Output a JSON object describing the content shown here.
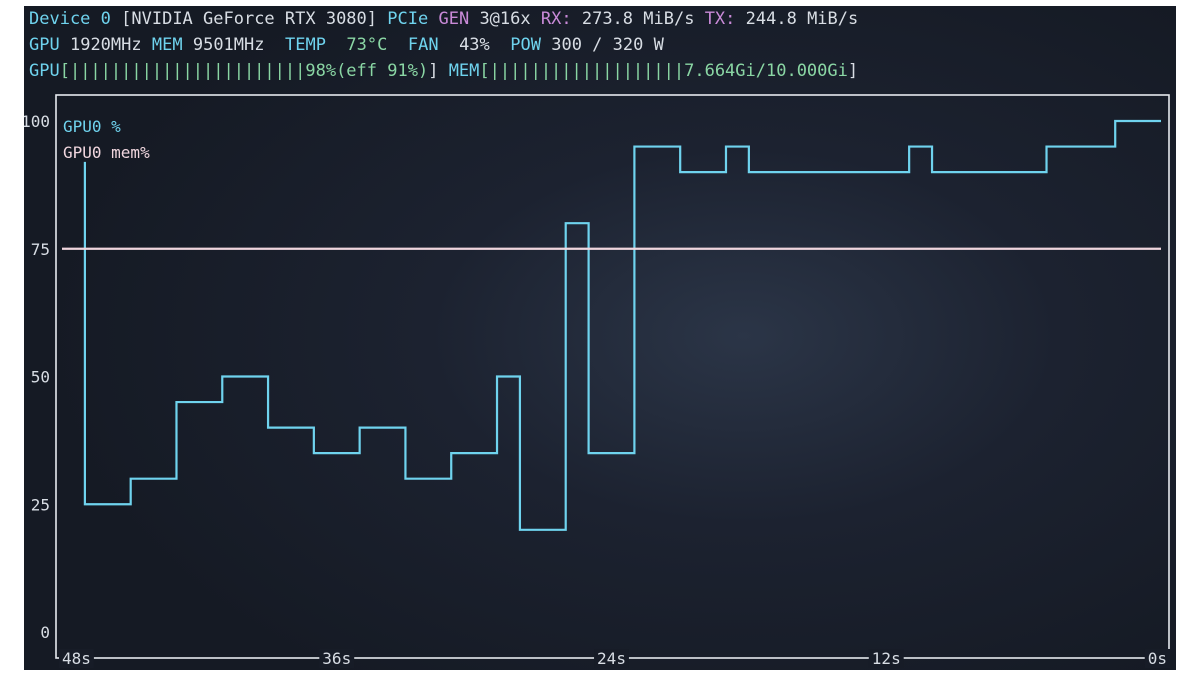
{
  "header": {
    "device": {
      "label": "Device 0",
      "name": "[NVIDIA GeForce RTX 3080]",
      "pcie_label": "PCIe",
      "gen_label": "GEN",
      "gen_value": "3@16x",
      "rx_label": "RX:",
      "rx_value": "273.8 MiB/s",
      "tx_label": "TX:",
      "tx_value": "244.8 MiB/s"
    },
    "stats": {
      "gpu_label": "GPU",
      "gpu_clock": "1920MHz",
      "mem_label": "MEM",
      "mem_clock": "9501MHz",
      "temp_label": "TEMP",
      "temp_value": "73°C",
      "fan_label": "FAN",
      "fan_value": "43%",
      "pow_label": "POW",
      "pow_value": "300 / 320 W"
    },
    "bars": {
      "gpu_label": "GPU",
      "gpu_bar": "[|||||||||||||||||||||||",
      "gpu_value": "98%(eff 91%)",
      "gpu_close": "]",
      "mem_label": "MEM",
      "mem_bar": "[|||||||||||||||||||",
      "mem_value": "7.664Gi/10.000Gi",
      "mem_close": "]",
      "gpu_fraction": 0.98,
      "mem_fraction": 0.7664
    }
  },
  "chart_data": {
    "type": "line",
    "series": [
      {
        "name": "GPU0 %",
        "color": "#6fd3ee",
        "x": [
          -47,
          -45,
          -43,
          -41,
          -39,
          -37,
          -35,
          -33,
          -31,
          -29,
          -28,
          -26,
          -25,
          -23,
          -21,
          -19,
          -18,
          -11,
          -10,
          -5,
          -4,
          -2
        ],
        "y": [
          25,
          30,
          45,
          50,
          40,
          35,
          40,
          30,
          35,
          50,
          20,
          80,
          35,
          95,
          90,
          95,
          90,
          95,
          90,
          95,
          95,
          100
        ],
        "step": "post",
        "start": {
          "x": -47,
          "y": 92
        },
        "end_x": 0
      },
      {
        "name": "GPU0 mem%",
        "color": "#f0d6de",
        "x": [
          -48,
          0
        ],
        "y": [
          75,
          75
        ]
      }
    ],
    "xlim": [
      -48,
      0
    ],
    "ylim": [
      0,
      100
    ],
    "x_ticks": [
      {
        "v": -48,
        "label": "48s"
      },
      {
        "v": -36,
        "label": "36s"
      },
      {
        "v": -24,
        "label": "24s"
      },
      {
        "v": -12,
        "label": "12s"
      },
      {
        "v": 0,
        "label": "0s"
      }
    ],
    "y_ticks": [
      {
        "v": 100,
        "label": "100"
      },
      {
        "v": 75,
        "label": "75"
      },
      {
        "v": 50,
        "label": "50"
      },
      {
        "v": 25,
        "label": "25"
      },
      {
        "v": 0,
        "label": "0"
      }
    ],
    "legend": "top-left",
    "grid": false
  }
}
